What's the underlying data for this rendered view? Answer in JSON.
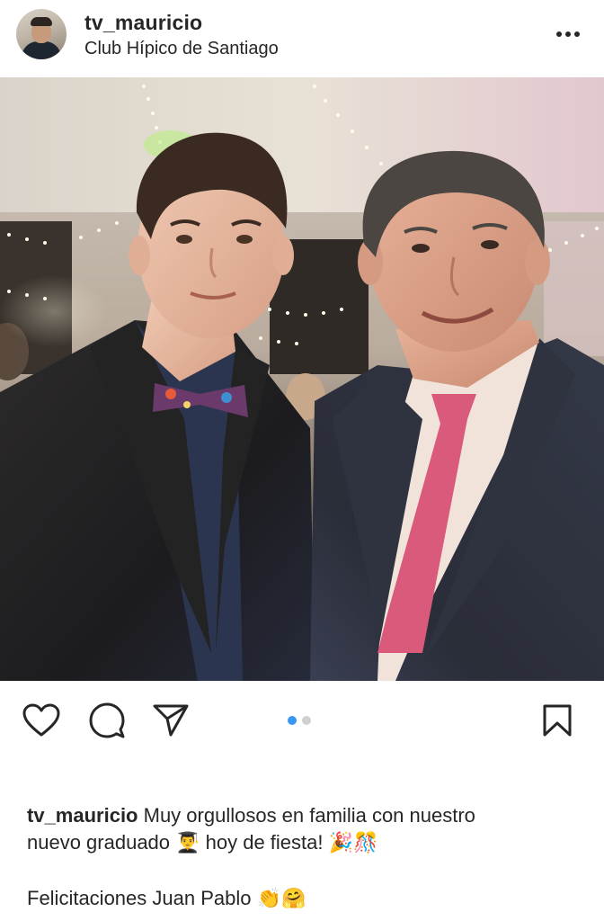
{
  "post": {
    "username": "tv_mauricio",
    "location": "Club Hípico de Santiago",
    "more_icon": "ellipsis-icon"
  },
  "actions": {
    "like_icon": "heart-icon",
    "comment_icon": "comment-icon",
    "share_icon": "send-icon",
    "save_icon": "bookmark-icon",
    "carousel_total": 2,
    "carousel_current": 1
  },
  "caption": {
    "username": "tv_mauricio",
    "text_line1": " Muy orgullosos en familia con nuestro",
    "text_line2": "nuevo graduado 👨‍🎓 hoy de fiesta! 🎉🎊",
    "text_line3": "Felicitaciones Juan Pablo 👏🤗"
  },
  "colors": {
    "text": "#262626",
    "carousel_active": "#3897f0",
    "carousel_inactive": "#d0d0d0"
  }
}
